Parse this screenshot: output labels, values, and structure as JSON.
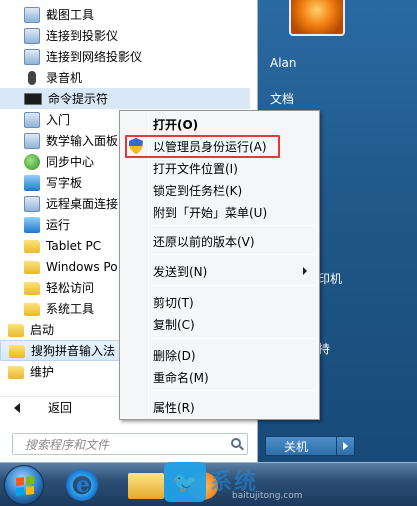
{
  "programs": [
    {
      "label": "截图工具",
      "icon": "scissors-icon"
    },
    {
      "label": "连接到投影仪",
      "icon": "projector-icon"
    },
    {
      "label": "连接到网络投影仪",
      "icon": "network-projector-icon"
    },
    {
      "label": "录音机",
      "icon": "microphone-icon"
    },
    {
      "label": "命令提示符",
      "icon": "cmd-icon"
    },
    {
      "label": "入门",
      "icon": "getting-started-icon"
    },
    {
      "label": "数学输入面板",
      "icon": "math-input-icon"
    },
    {
      "label": "同步中心",
      "icon": "sync-center-icon"
    },
    {
      "label": "写字板",
      "icon": "wordpad-icon"
    },
    {
      "label": "远程桌面连接",
      "icon": "remote-desktop-icon"
    },
    {
      "label": "运行",
      "icon": "run-icon"
    },
    {
      "label": "Tablet PC",
      "icon": "folder-icon"
    },
    {
      "label": "Windows Po",
      "icon": "folder-icon"
    },
    {
      "label": "轻松访问",
      "icon": "folder-icon"
    },
    {
      "label": "系统工具",
      "icon": "folder-icon"
    },
    {
      "label": "启动",
      "icon": "folder-icon"
    },
    {
      "label": "搜狗拼音输入法",
      "icon": "folder-icon"
    },
    {
      "label": "维护",
      "icon": "folder-icon"
    }
  ],
  "back_label": "返回",
  "search_placeholder": "搜索程序和文件",
  "right_pane": {
    "user": "Alan",
    "documents": "文档",
    "printers_partial": "印机",
    "help_partial": "持"
  },
  "shutdown_label": "关机",
  "context_menu": {
    "items": [
      {
        "label": "打开(O)",
        "bold": true
      },
      {
        "label": "以管理员身份运行(A)",
        "icon": "uac-shield-icon",
        "highlighted": true
      },
      {
        "label": "打开文件位置(I)"
      },
      {
        "label": "锁定到任务栏(K)"
      },
      {
        "label": "附到「开始」菜单(U)"
      },
      {
        "label": "还原以前的版本(V)"
      },
      {
        "label": "发送到(N)",
        "submenu": true
      },
      {
        "label": "剪切(T)"
      },
      {
        "label": "复制(C)"
      },
      {
        "label": "删除(D)"
      },
      {
        "label": "重命名(M)"
      },
      {
        "label": "属性(R)"
      }
    ]
  },
  "watermark": {
    "text": "系统",
    "url_partial": "baitujitong.com"
  },
  "colors": {
    "highlight_border": "#e03a3a",
    "right_pane": "#1f5889"
  }
}
